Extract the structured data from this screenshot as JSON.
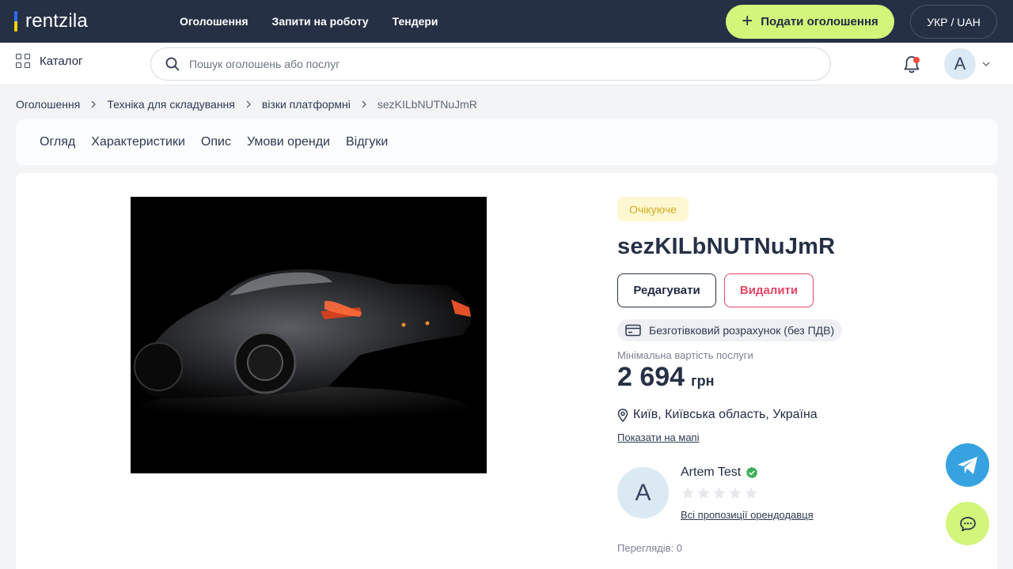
{
  "header": {
    "logo": "rentzila",
    "nav": [
      "Оголошення",
      "Запити на роботу",
      "Тендери"
    ],
    "post_button": "Подати оголошення",
    "lang": "УКР / UAH"
  },
  "subbar": {
    "catalog": "Каталог",
    "search_placeholder": "Пошук оголошень або послуг",
    "avatar_letter": "A"
  },
  "breadcrumb": [
    "Оголошення",
    "Техніка для складування",
    "візки платформні",
    "sezKILbNUTNuJmR"
  ],
  "tabs": [
    "Огляд",
    "Характеристики",
    "Опис",
    "Умови оренди",
    "Відгуки"
  ],
  "listing": {
    "status": "Очікуюче",
    "title": "sezKILbNUTNuJmR",
    "edit": "Редагувати",
    "delete": "Видалити",
    "payment": "Безготівковий розрахунок (без ПДВ)",
    "price_label": "Мінімальна вартість послуги",
    "price": "2 694",
    "currency": "грн",
    "location": "Київ, Київська область, Україна",
    "map_link": "Показати на мапі"
  },
  "owner": {
    "avatar_letter": "A",
    "name": "Artem Test",
    "rating": 0,
    "rating_max": 5,
    "link": "Всі пропозиції орендодавця"
  },
  "views": "Переглядів: 0",
  "colors": {
    "header_bg": "#263045",
    "accent_green": "#d2f57a",
    "danger": "#e54566",
    "pending_text": "#d7a81c",
    "telegram": "#36a3e0"
  }
}
